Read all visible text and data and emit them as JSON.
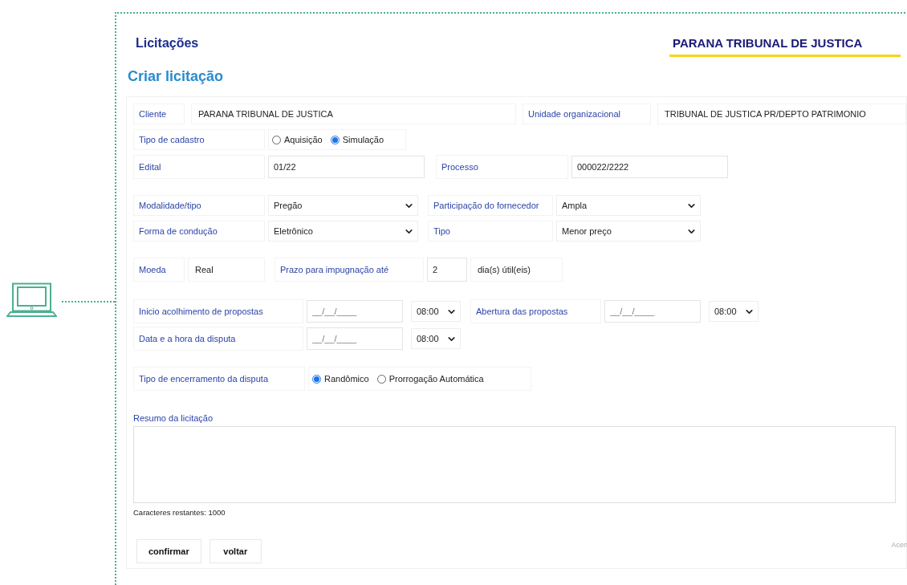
{
  "page": {
    "section": "Licitações",
    "brand": "PARANA TRIBUNAL DE JUSTICA",
    "title": "Criar licitação"
  },
  "form": {
    "cliente": {
      "label": "Cliente",
      "value": "PARANA TRIBUNAL DE JUSTICA"
    },
    "unidade": {
      "label": "Unidade organizacional",
      "value": "TRIBUNAL DE JUSTICA PR/DEPTO PATRIMONIO"
    },
    "tipo_cadastro": {
      "label": "Tipo de cadastro",
      "options": [
        {
          "label": "Aquisição",
          "selected": false
        },
        {
          "label": "Simulação",
          "selected": true
        }
      ]
    },
    "edital": {
      "label": "Edital",
      "value": "01/22"
    },
    "processo": {
      "label": "Processo",
      "value": "000022/2222"
    },
    "modalidade": {
      "label": "Modalidade/tipo",
      "value": "Pregão"
    },
    "participacao": {
      "label": "Participação do fornecedor",
      "value": "Ampla"
    },
    "forma": {
      "label": "Forma de condução",
      "value": "Eletrônico"
    },
    "tipo": {
      "label": "Tipo",
      "value": "Menor preço"
    },
    "moeda": {
      "label": "Moeda",
      "value": "Real"
    },
    "prazo": {
      "label": "Prazo para impugnação até",
      "value": "2",
      "suffix": "dia(s) útil(eis)"
    },
    "inicio": {
      "label": "Inicio acolhimento de propostas",
      "placeholder": "__/__/____",
      "time": "08:00"
    },
    "abertura": {
      "label": "Abertura das propostas",
      "placeholder": "__/__/____",
      "time": "08:00"
    },
    "disputa": {
      "label": "Data e a hora da disputa",
      "placeholder": "__/__/____",
      "time": "08:00"
    },
    "encerramento": {
      "label": "Tipo de encerramento da disputa",
      "options": [
        {
          "label": "Randômico",
          "selected": true
        },
        {
          "label": "Prorrogação Automática",
          "selected": false
        }
      ]
    },
    "resumo": {
      "label": "Resumo da licitação"
    },
    "remaining": "Caracteres restantes: 1000"
  },
  "buttons": [
    "confirmar",
    "voltar"
  ],
  "edge_text": "Acen"
}
